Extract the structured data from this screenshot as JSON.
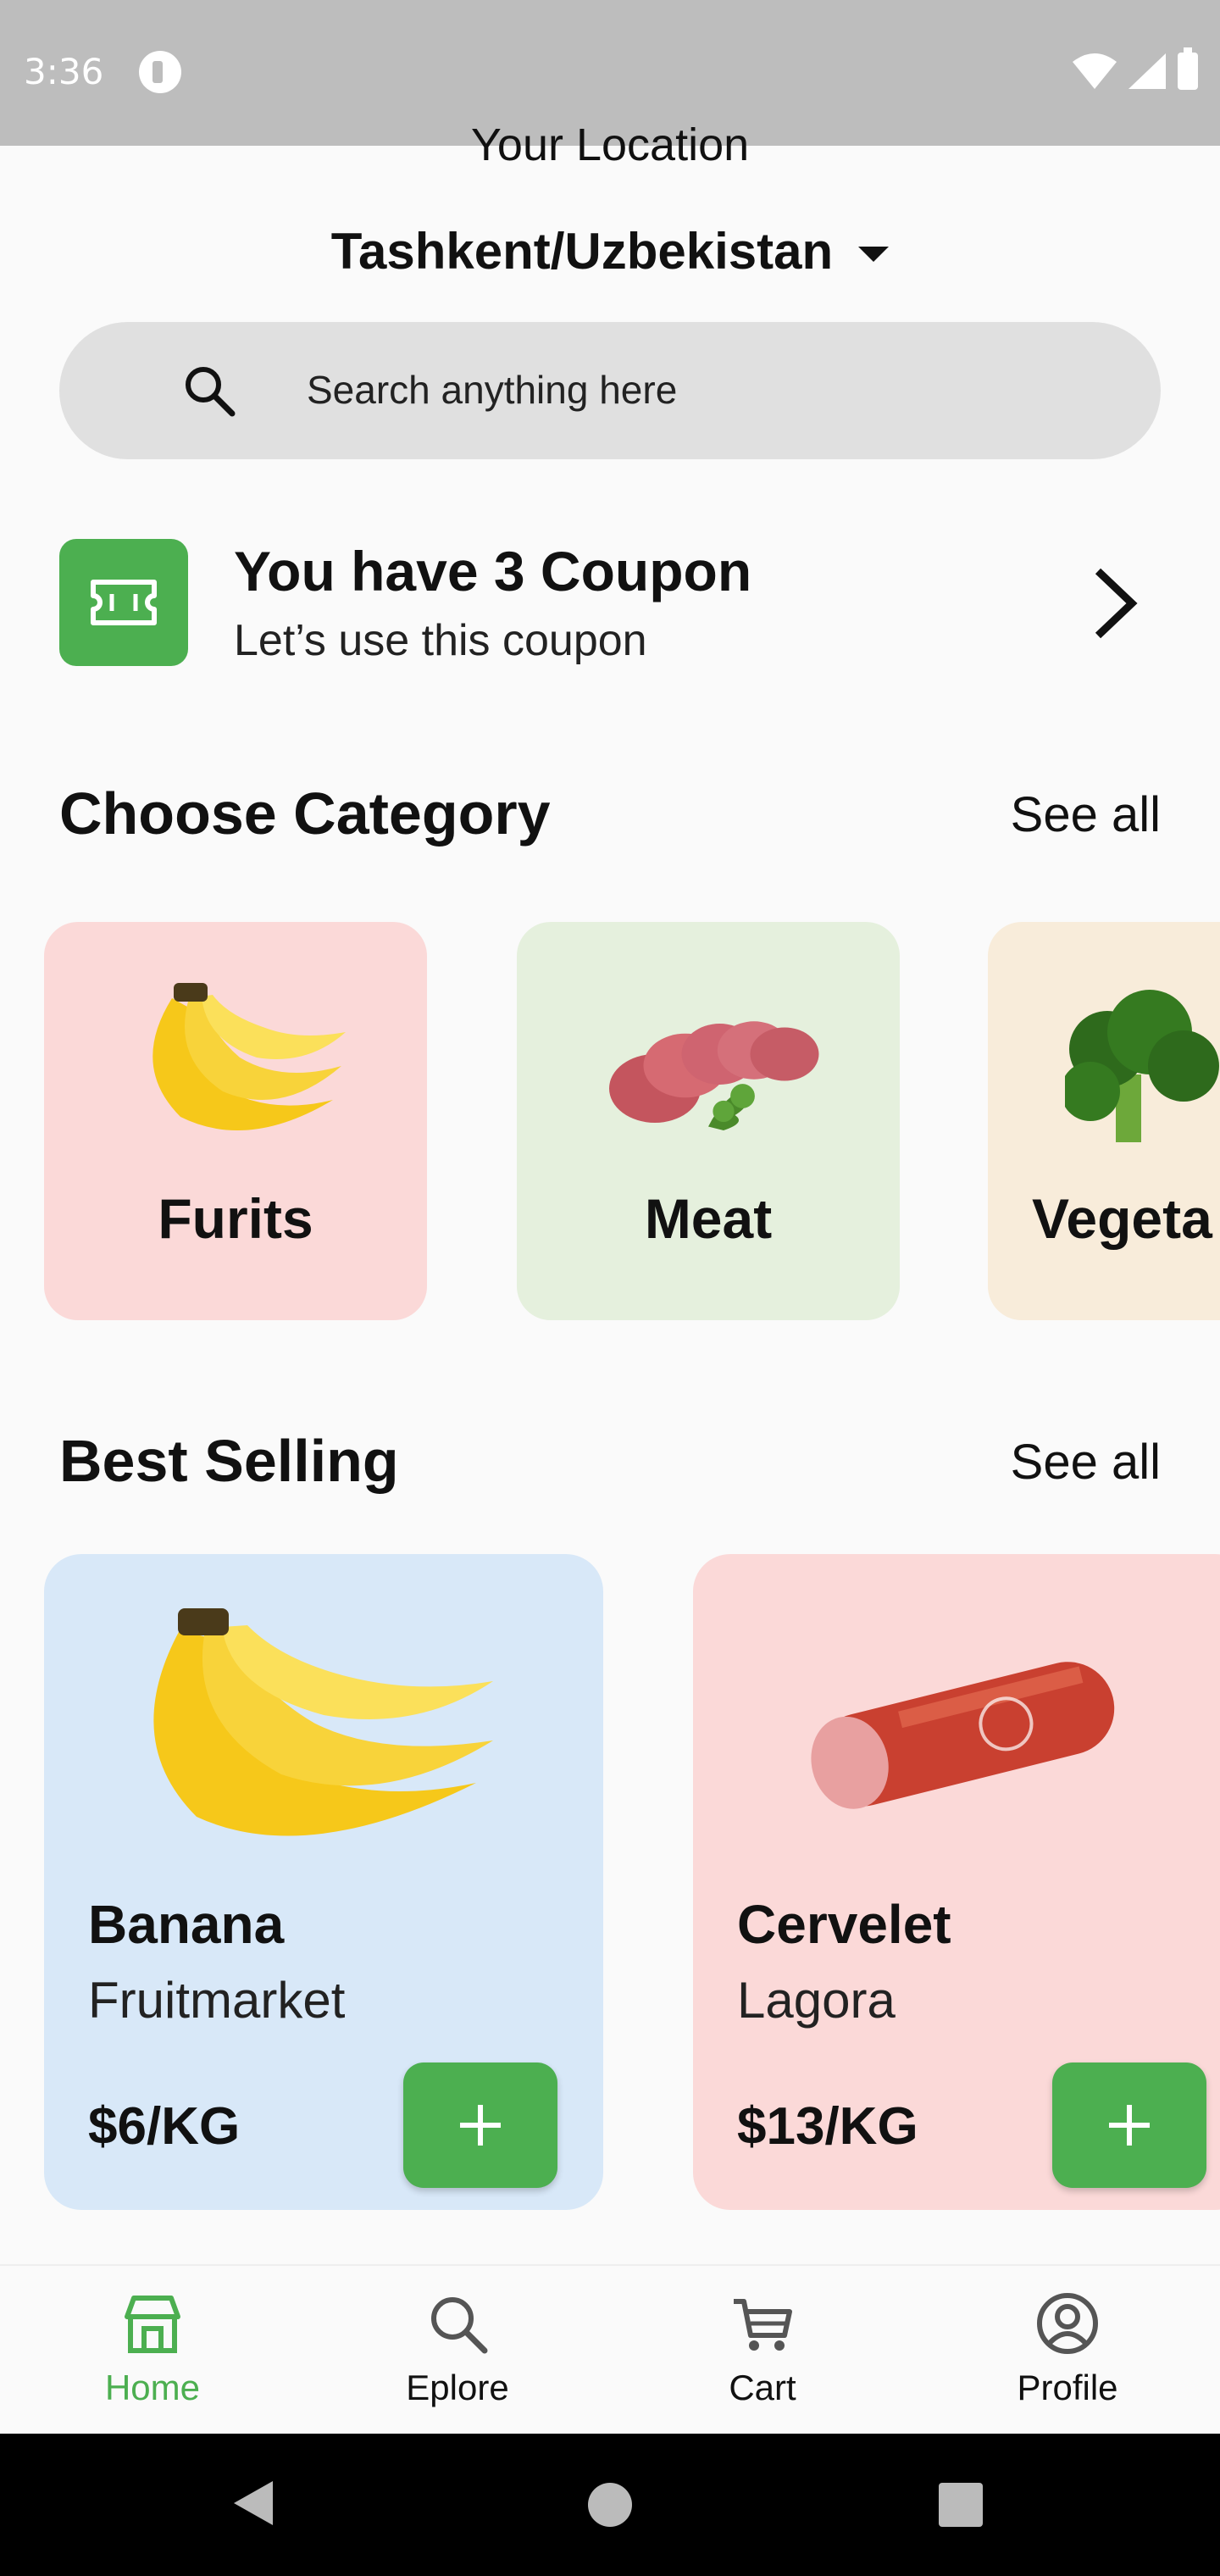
{
  "status_bar": {
    "time": "3:36"
  },
  "header": {
    "location_label": "Your Location",
    "location_value": "Tashkent/Uzbekistan"
  },
  "search": {
    "placeholder": "Search anything here"
  },
  "coupon": {
    "title": "You have 3 Coupon",
    "subtitle": "Let’s use this coupon"
  },
  "categories": {
    "title": "Choose Category",
    "see_all": "See all",
    "items": [
      {
        "label": "Furits",
        "bg": "#fbd9d8",
        "icon": "banana-image"
      },
      {
        "label": "Meat",
        "bg": "#e5f0dd",
        "icon": "meat-image"
      },
      {
        "label": "Vegeta",
        "bg": "#f8ecda",
        "icon": "broccoli-image"
      }
    ]
  },
  "best_selling": {
    "title": "Best Selling",
    "see_all": "See all",
    "items": [
      {
        "name": "Banana",
        "vendor": "Fruitmarket",
        "price": "$6/KG",
        "bg": "#d8e8f8",
        "icon": "banana-image"
      },
      {
        "name": "Cervelet",
        "vendor": "Lagora",
        "price": "$13/KG",
        "bg": "#fbd9d8",
        "icon": "sausage-image"
      }
    ]
  },
  "bottom_nav": {
    "items": [
      {
        "label": "Home",
        "active": true
      },
      {
        "label": "Eplore",
        "active": false
      },
      {
        "label": "Cart",
        "active": false
      },
      {
        "label": "Profile",
        "active": false
      }
    ]
  },
  "colors": {
    "accent": "#4caf50",
    "status_bar": "#bdbdbd"
  }
}
